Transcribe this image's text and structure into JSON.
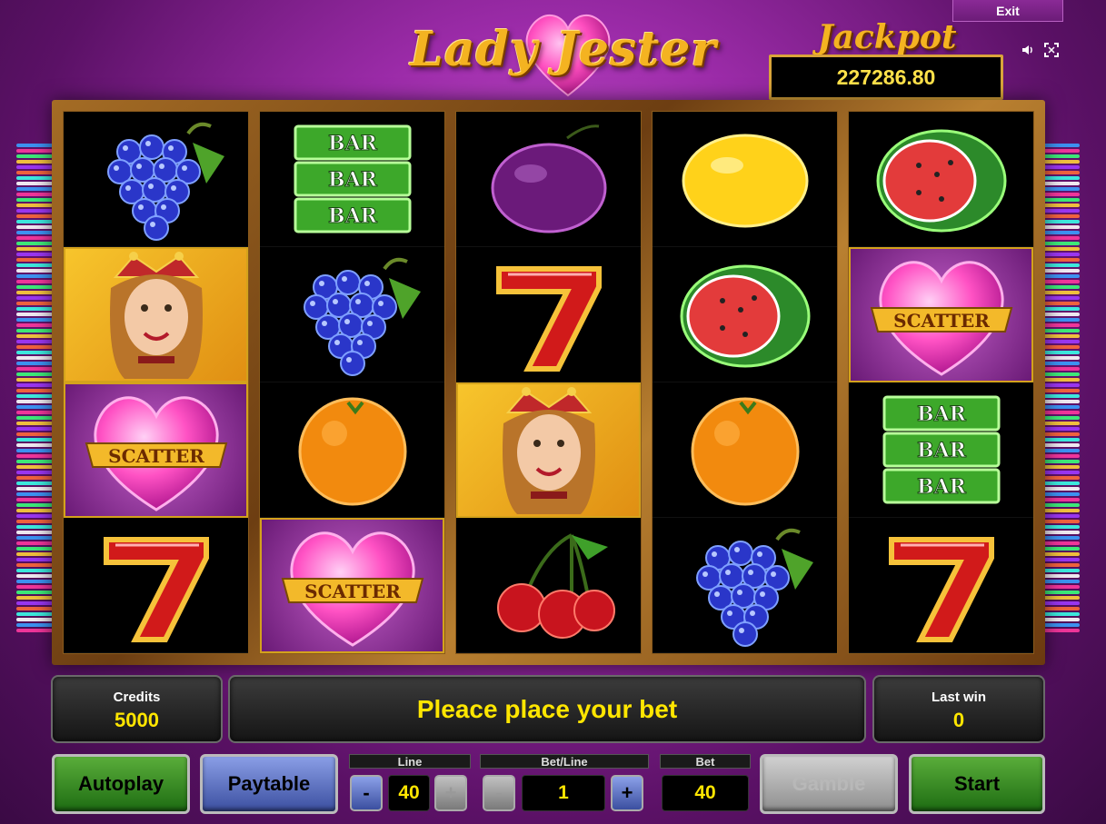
{
  "header": {
    "logo_text": "Lady Jester",
    "jackpot_title": "Jackpot",
    "jackpot_value": "227286.80",
    "exit_label": "Exit",
    "sound_icon": "speaker-icon",
    "fullscreen_icon": "fullscreen-icon"
  },
  "reels": [
    [
      "grapes",
      "jester",
      "scatter",
      "seven"
    ],
    [
      "bar",
      "grapes",
      "orange",
      "scatter"
    ],
    [
      "plum",
      "seven",
      "jester",
      "cherries"
    ],
    [
      "lemon",
      "watermelon",
      "orange",
      "grapes"
    ],
    [
      "watermelon",
      "scatter",
      "bar",
      "seven"
    ]
  ],
  "symbol_text": {
    "bar": "BAR",
    "scatter": "SCATTER"
  },
  "panels": {
    "credits_label": "Credits",
    "credits_value": "5000",
    "message": "Pleace place your bet",
    "lastwin_label": "Last win",
    "lastwin_value": "0"
  },
  "controls": {
    "autoplay_label": "Autoplay",
    "paytable_label": "Paytable",
    "line_label": "Line",
    "line_value": "40",
    "betline_label": "Bet/Line",
    "betline_value": "1",
    "bet_label": "Bet",
    "bet_value": "40",
    "gamble_label": "Gamble",
    "start_label": "Start",
    "minus": "-",
    "plus": "+"
  },
  "colors": {
    "accent_gold": "#f4b321",
    "value_yellow": "#ffe600",
    "green_button": "#2e8a1f",
    "blue_button": "#4a5fb5",
    "disabled_button": "#a5a5a5"
  }
}
